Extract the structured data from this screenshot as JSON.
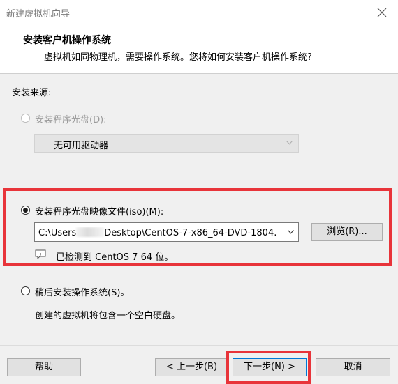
{
  "window": {
    "title": "新建虚拟机向导"
  },
  "header": {
    "title": "安装客户机操作系统",
    "subtitle": "虚拟机如同物理机，需要操作系统。您将如何安装客户机操作系统?"
  },
  "install_source": {
    "label": "安装来源:",
    "options": [
      {
        "label": "安装程序光盘(D):",
        "selected": false,
        "disabled": true
      },
      {
        "label": "安装程序光盘映像文件(iso)(M):",
        "selected": true,
        "disabled": false
      },
      {
        "label": "稍后安装操作系统(S)。",
        "selected": false,
        "disabled": false
      }
    ],
    "disc_drive_value": "无可用驱动器",
    "iso_path_prefix": "C:\\Users",
    "iso_path_suffix": "Desktop\\CentOS-7-x86_64-DVD-1804.",
    "browse_button": "浏览(R)...",
    "detected_text": "已检测到 CentOS 7 64 位。",
    "later_description": "创建的虚拟机将包含一个空白硬盘。"
  },
  "footer": {
    "help": "帮助",
    "back": "< 上一步(B)",
    "next": "下一步(N) >",
    "cancel": "取消"
  },
  "colors": {
    "highlight": "#e8343a",
    "focus_border": "#0078d7"
  }
}
